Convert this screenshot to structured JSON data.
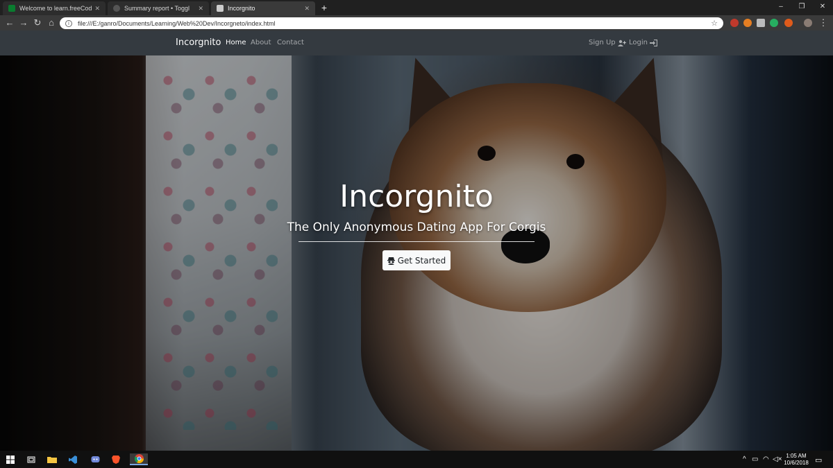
{
  "browser": {
    "tabs": [
      {
        "title": "Welcome to learn.freeCodeCamp",
        "favicon_color": "#0a7c2f"
      },
      {
        "title": "Summary report • Toggl",
        "favicon_color": "#555555"
      },
      {
        "title": "Incorgnito",
        "favicon_color": "#cccccc",
        "active": true
      }
    ],
    "new_tab": "+",
    "url": "file:///E:/ganro/Documents/Learning/Web%20Dev/Incorgneto/index.html",
    "window_controls": [
      "–",
      "❐",
      "✕"
    ]
  },
  "site": {
    "brand": "Incorgnito",
    "nav": {
      "home": "Home",
      "about": "About",
      "contact": "Contact",
      "signup": "Sign Up",
      "login": "Login"
    },
    "hero": {
      "title": "Incorgnito",
      "subtitle": "The Only Anonymous Dating App For Corgis",
      "cta": "Get Started"
    }
  },
  "taskbar": {
    "time": "1:05 AM",
    "date": "10/6/2018"
  },
  "colors": {
    "navbar": "#343a40",
    "button_bg": "#f8f9fa"
  }
}
